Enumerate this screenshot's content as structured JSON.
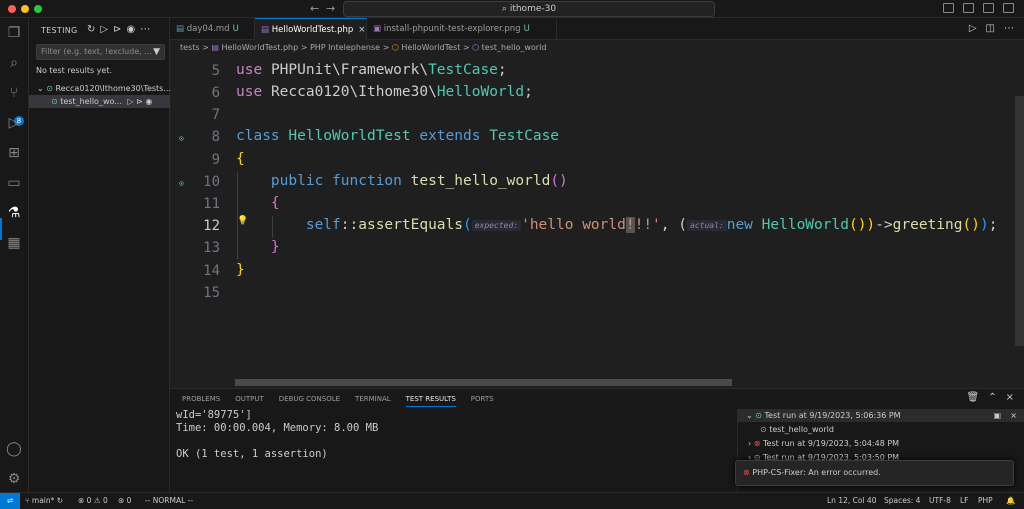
{
  "window": {
    "search": "ithome-30",
    "nav_back": "←",
    "nav_forward": "→"
  },
  "sidebar": {
    "title": "TESTING",
    "filter_placeholder": "Filter (e.g. text, !exclude, ...",
    "no_results": "No test results yet.",
    "tree_root": "Recca0120\\Ithome30\\Tests...",
    "tree_child": "test_hello_wo..."
  },
  "tabs": [
    {
      "label": "day04.md",
      "status": "U"
    },
    {
      "label": "HelloWorldTest.php",
      "status": ""
    },
    {
      "label": "install-phpunit-test-explorer.png",
      "status": "U"
    }
  ],
  "breadcrumbs": [
    "tests",
    ">",
    "HelloWorldTest.php",
    ">",
    "PHP Intelephense",
    ">",
    "HelloWorldTest",
    ">",
    "test_hello_world"
  ],
  "editor": {
    "line_numbers": [
      "5",
      "6",
      "7",
      "8",
      "9",
      "10",
      "11",
      "12",
      "13",
      "14",
      "15"
    ],
    "l5_use": "use",
    "l5_ns": "PHPUnit\\Framework\\",
    "l5_cls": "TestCase",
    "l5_semi": ";",
    "l6_use": "use",
    "l6_ns": "Recca0120\\Ithome30\\",
    "l6_cls": "HelloWorld",
    "l6_semi": ";",
    "l8_kw": "class",
    "l8_name": "HelloWorldTest",
    "l8_ext": "extends",
    "l8_base": "TestCase",
    "brace_open": "{",
    "brace_close": "}",
    "l10_pub": "public",
    "l10_fn": "function",
    "l10_name": "test_hello_world",
    "l10_parens": "()",
    "l12_self": "self",
    "l12_sep": "::",
    "l12_method": "assertEquals",
    "l12_lp": "(",
    "hint_expected": "expected:",
    "l12_str_a": "'hello world",
    "l12_str_cursor": "!",
    "l12_str_b": "!!'",
    "l12_comma": ", (",
    "hint_actual": "actual:",
    "l12_new": "new",
    "l12_cls": "HelloWorld",
    "l12_p1": "())",
    "l12_arrow": "->",
    "l12_greet": "greeting",
    "l12_p2": "()",
    "l12_rp": ")",
    "l12_end": ";"
  },
  "panel": {
    "tabs": [
      "PROBLEMS",
      "OUTPUT",
      "DEBUG CONSOLE",
      "TERMINAL",
      "TEST RESULTS",
      "PORTS"
    ],
    "active_tab": "TEST RESULTS",
    "output": "wId='89775']\nTime: 00:00.004, Memory: 8.00 MB\n\nOK (1 test, 1 assertion)",
    "runs": [
      {
        "label": "Test run at 9/19/2023, 5:06:36 PM",
        "state": "pass"
      },
      {
        "label": "test_hello_world",
        "state": "pass"
      },
      {
        "label": "Test run at 9/19/2023, 5:04:48 PM",
        "state": "fail"
      },
      {
        "label": "Test run at 9/19/2023, 5:03:50 PM",
        "state": "pass"
      }
    ]
  },
  "notification": "PHP-CS-Fixer: An error occurred.",
  "statusbar": {
    "branch": "main*",
    "errors": "0",
    "warnings": "0",
    "ports": "0",
    "mode": "-- NORMAL --",
    "position": "Ln 12, Col 40",
    "spaces": "Spaces: 4",
    "encoding": "UTF-8",
    "eol": "LF",
    "language": "PHP"
  },
  "colors": {
    "accent": "#0078d4",
    "pass": "#73c991",
    "fail": "#f14c4c"
  }
}
